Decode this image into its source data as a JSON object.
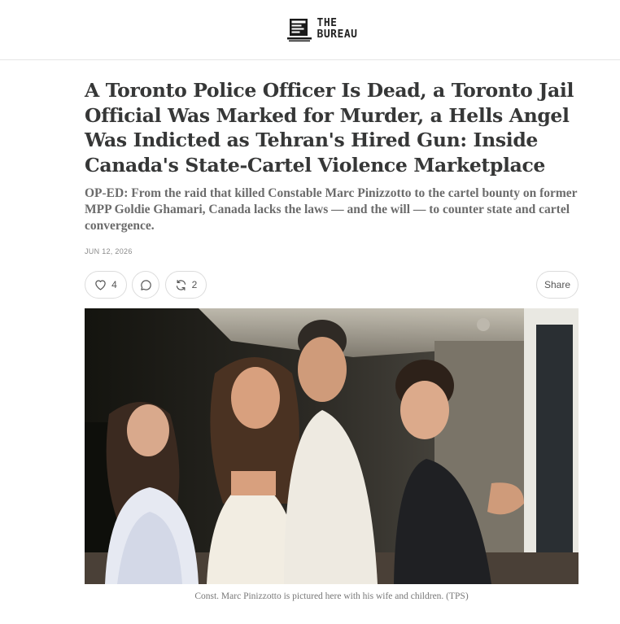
{
  "header": {
    "brand_line1": "THE",
    "brand_line2": "BUREAU",
    "logo_icon": "computer-monitor-icon"
  },
  "article": {
    "title": "A Toronto Police Officer Is Dead, a Toronto Jail Official Was Marked for Murder, a Hells Angel Was Indicted as Tehran's Hired Gun: Inside Canada's State-Cartel Violence Marketplace",
    "subtitle": "OP-ED: From the raid that killed Constable Marc Pinizzotto to the cartel bounty on former MPP Goldie Ghamari, Canada lacks the laws — and the will — to counter state and cartel convergence.",
    "date": "JUN 12, 2026"
  },
  "actions": {
    "like_count": "4",
    "restack_count": "2",
    "share_label": "Share",
    "icons": [
      "heart-icon",
      "comment-icon",
      "restack-icon"
    ]
  },
  "image": {
    "caption": "Const. Marc Pinizzotto is pictured here with his wife and children. (TPS)"
  }
}
